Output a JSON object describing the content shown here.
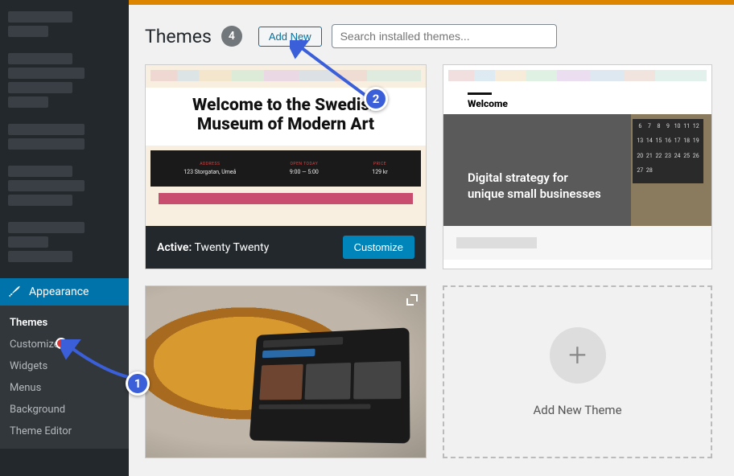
{
  "page": {
    "title": "Themes",
    "count": "4",
    "add_new": "Add New",
    "search_placeholder": "Search installed themes..."
  },
  "sidebar": {
    "appearance": "Appearance",
    "submenu": [
      "Themes",
      "Customize",
      "Widgets",
      "Menus",
      "Background",
      "Theme Editor"
    ]
  },
  "theme1": {
    "screenshot_title_line1": "Welcome to the Swedish",
    "screenshot_title_line2": "Museum of Modern Art",
    "info_address_lbl": "ADDRESS",
    "info_address_val": "123 Storgatan, Umeå",
    "info_open_lbl": "OPEN TODAY",
    "info_open_val": "9:00 — 5:00",
    "info_price_lbl": "PRICE",
    "info_price_val": "129 kr",
    "active_prefix": "Active:",
    "name": "Twenty Twenty",
    "customize": "Customize"
  },
  "theme2": {
    "welcome": "Welcome",
    "tagline": "Digital strategy for unique small businesses",
    "cal": [
      "6",
      "7",
      "8",
      "9",
      "10",
      "11",
      "12",
      "13",
      "14",
      "15",
      "16",
      "17",
      "18",
      "19",
      "20",
      "21",
      "22",
      "23",
      "24",
      "25",
      "26",
      "27",
      "28"
    ]
  },
  "add_card": {
    "label": "Add New Theme"
  },
  "annotations": {
    "one": "1",
    "two": "2"
  }
}
